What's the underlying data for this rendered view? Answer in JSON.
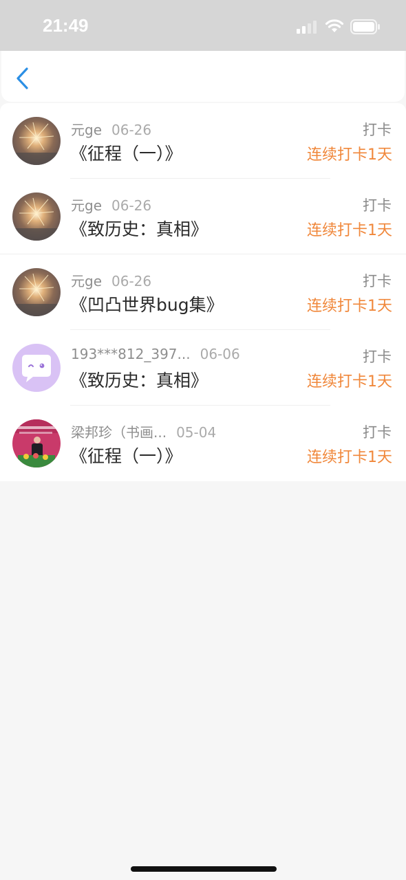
{
  "status_bar": {
    "time": "21:49",
    "icons": [
      "cellular-signal-icon",
      "wifi-icon",
      "battery-icon"
    ]
  },
  "nav": {
    "back_icon": "chevron-left-icon",
    "accent_color": "#2b8fe5"
  },
  "colors": {
    "streak": "#f0873a",
    "background": "#f6f6f6"
  },
  "items": [
    {
      "avatar": "sparkler-photo",
      "user": "元ge",
      "date": "06-26",
      "title": "《征程（一）》",
      "action": "打卡",
      "streak": "连续打卡1天"
    },
    {
      "avatar": "sparkler-photo",
      "user": "元ge",
      "date": "06-26",
      "title": "《致历史：真相》",
      "action": "打卡",
      "streak": "连续打卡1天"
    },
    {
      "avatar": "sparkler-photo",
      "user": "元ge",
      "date": "06-26",
      "title": "《凹凸世界bug集》",
      "action": "打卡",
      "streak": "连续打卡1天"
    },
    {
      "avatar": "default-chat-avatar",
      "user": "193***812_397...",
      "date": "06-06",
      "title": "《致历史：真相》",
      "action": "打卡",
      "streak": "连续打卡1天"
    },
    {
      "avatar": "speaker-photo",
      "user": "梁邦珍（书画...",
      "date": "05-04",
      "title": "《征程（一）》",
      "action": "打卡",
      "streak": "连续打卡1天"
    }
  ]
}
